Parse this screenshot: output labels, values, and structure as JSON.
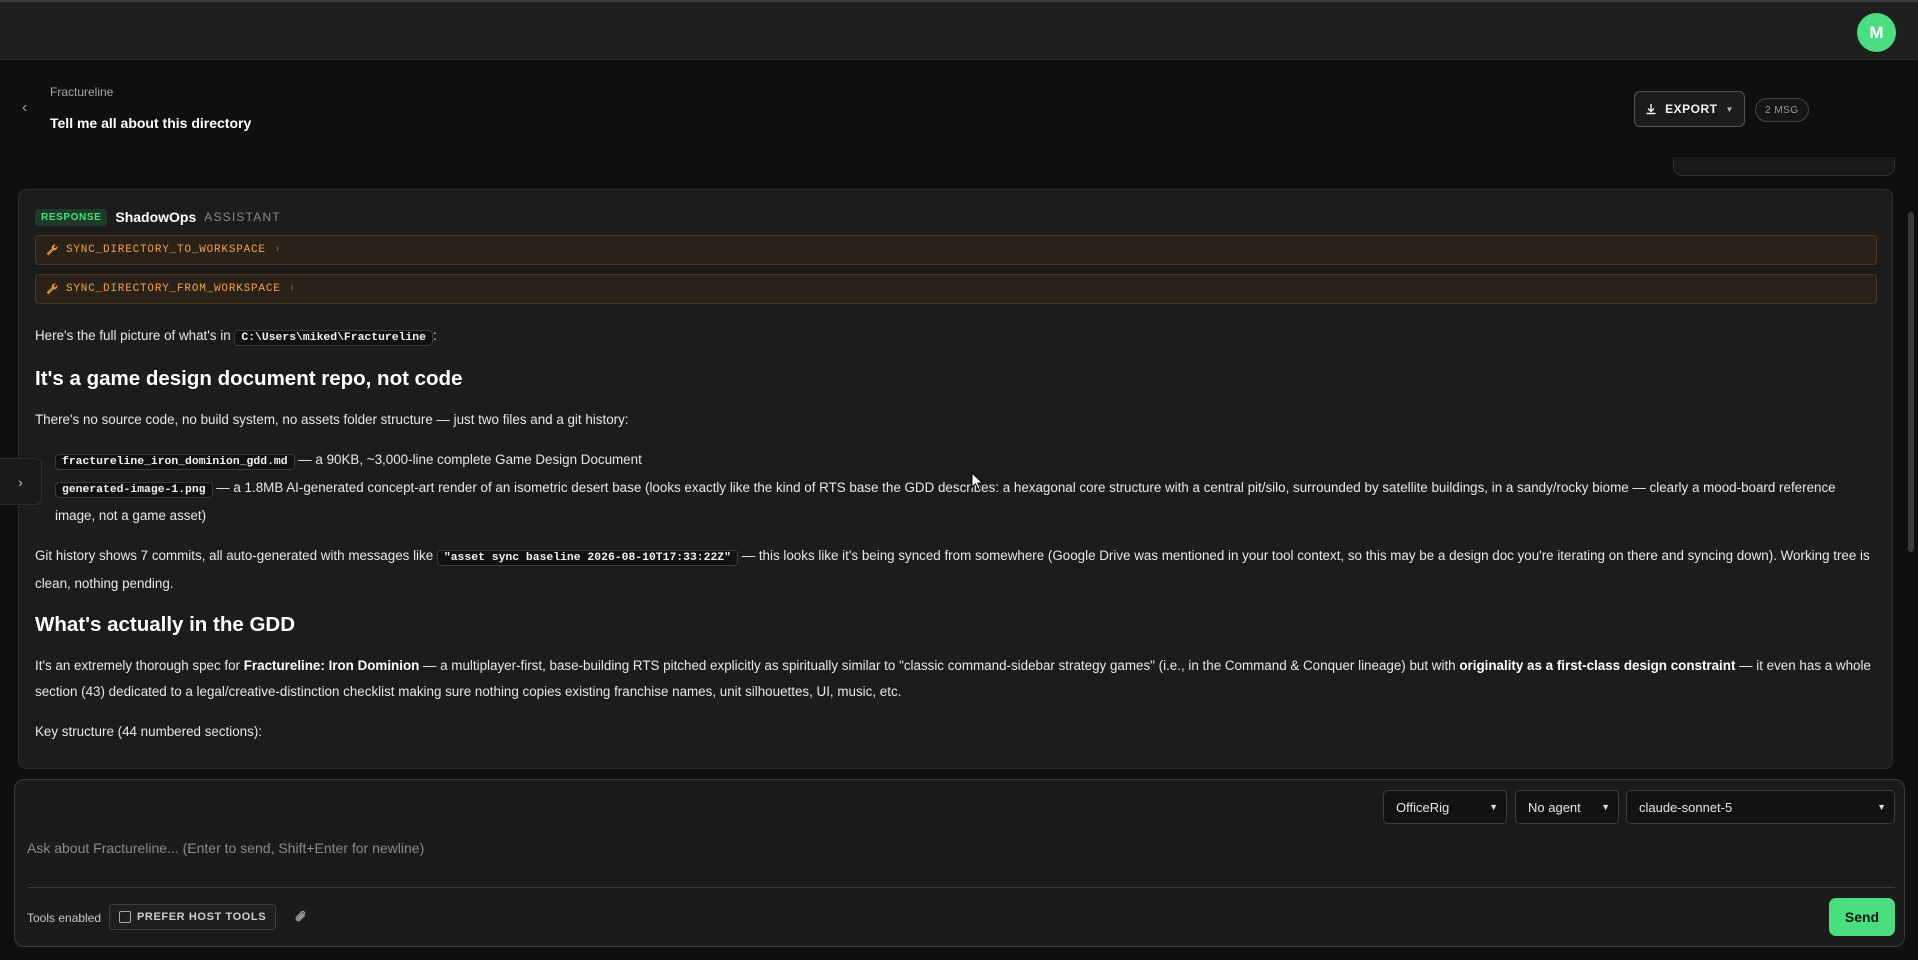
{
  "topbar": {
    "avatar_initial": "M"
  },
  "header": {
    "back_icon": "chevron-left-icon",
    "project": "Fractureline",
    "title": "Tell me all about this directory",
    "export_label": "EXPORT",
    "message_count": "2 MSG"
  },
  "sidebar_toggle": {
    "icon": "chevron-right-icon",
    "glyph": "›"
  },
  "message": {
    "badge": "RESPONSE",
    "agent": "ShadowOps",
    "role": "ASSISTANT",
    "tool_calls": [
      {
        "icon": "wrench-icon",
        "name": "SYNC_DIRECTORY_TO_WORKSPACE"
      },
      {
        "icon": "wrench-icon",
        "name": "SYNC_DIRECTORY_FROM_WORKSPACE"
      }
    ],
    "intro_text": "Here's the full picture of what's in ",
    "intro_path": "C:\\Users\\miked\\Fractureline",
    "intro_suffix": ":",
    "heading1": "It's a game design document repo, not code",
    "para1": "There's no source code, no build system, no assets folder structure — just two files and a git history:",
    "files": [
      {
        "name": "fractureline_iron_dominion_gdd.md",
        "desc": " — a 90KB, ~3,000-line complete Game Design Document"
      },
      {
        "name": "generated-image-1.png",
        "desc": " — a 1.8MB AI-generated concept-art render of an isometric desert base (looks exactly like the kind of RTS base the GDD describes: a hexagonal core structure with a central pit/silo, surrounded by satellite buildings, in a sandy/rocky biome — clearly a mood-board reference image, not a game asset)"
      }
    ],
    "git_prefix": "Git history shows 7 commits, all auto-generated with messages like ",
    "git_code": "\"asset sync baseline 2026-08-10T17:33:22Z\"",
    "git_suffix": " — this looks like it's being synced from somewhere (Google Drive was mentioned in your tool context, so this may be a design doc you're iterating on there and syncing down). Working tree is clean, nothing pending.",
    "heading2": "What's actually in the GDD",
    "gdd_prefix": "It's an extremely thorough spec for ",
    "gdd_bold1": "Fractureline: Iron Dominion",
    "gdd_middle": " — a multiplayer-first, base-building RTS pitched explicitly as spiritually similar to \"classic command-sidebar strategy games\" (i.e., in the Command & Conquer lineage) but with ",
    "gdd_bold2": "originality as a first-class design constraint",
    "gdd_suffix": " — it even has a whole section (43) dedicated to a legal/creative-distinction checklist making sure nothing copies existing franchise names, unit silhouettes, UI, music, etc.",
    "key_structure": "Key structure (44 numbered sections):"
  },
  "composer": {
    "host_select": "OfficeRig",
    "agent_select": "No agent",
    "model_select": "claude-sonnet-5",
    "placeholder": "Ask about Fractureline... (Enter to send, Shift+Enter for newline)",
    "tools_label": "Tools enabled",
    "prefer_host_label": "PREFER HOST TOOLS",
    "prefer_host_checked": false,
    "attach_icon": "paperclip-icon",
    "send_label": "Send"
  },
  "colors": {
    "accent_green": "#4ade80",
    "tool_orange": "#f0a04b",
    "background": "#0f0f10",
    "card": "#1c1c1c"
  }
}
